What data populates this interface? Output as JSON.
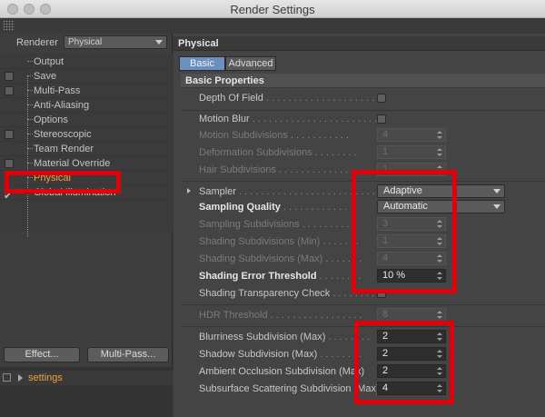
{
  "window": {
    "title": "Render Settings"
  },
  "renderer": {
    "label": "Renderer",
    "value": "Physical"
  },
  "tree": {
    "items": [
      {
        "label": "Output",
        "checkbox": false
      },
      {
        "label": "Save",
        "checkbox": true
      },
      {
        "label": "Multi-Pass",
        "checkbox": true
      },
      {
        "label": "Anti-Aliasing",
        "checkbox": false
      },
      {
        "label": "Options",
        "checkbox": false
      },
      {
        "label": "Stereoscopic",
        "checkbox": true
      },
      {
        "label": "Team Render",
        "checkbox": false
      },
      {
        "label": "Material Override",
        "checkbox": true
      },
      {
        "label": "Physical",
        "checkbox": false,
        "selected": true
      },
      {
        "label": "Global Illumination",
        "checkbox": false,
        "checked": true
      }
    ]
  },
  "buttons": {
    "effect": "Effect...",
    "multipass": "Multi-Pass..."
  },
  "presets": {
    "label": "settings"
  },
  "panel": {
    "title": "Physical",
    "tabs": [
      {
        "label": "Basic",
        "active": true
      },
      {
        "label": "Advanced",
        "active": false
      }
    ],
    "section": "Basic Properties",
    "rows": {
      "depth_of_field": {
        "label": "Depth Of Field",
        "dots": " . . . . . . . . . . . . . . . . . . . . ."
      },
      "motion_blur": {
        "label": "Motion Blur",
        "dots": " . . . . . . . . . . . . . . . . . . . . . . . ."
      },
      "motion_subdivisions": {
        "label": "Motion Subdivisions",
        "dots": " . . . . . . . . . . .",
        "value": "4"
      },
      "deformation_subdivisions": {
        "label": "Deformation Subdivisions",
        "dots": " . . . . . . . .",
        "value": "1"
      },
      "hair_subdivisions": {
        "label": "Hair Subdivisions",
        "dots": " . . . . . . . . . . . . . . .",
        "value": "1"
      },
      "sampler": {
        "label": "Sampler",
        "dots": " . . . . . . . . . . . . . . . . . . . . . . . . .",
        "value": "Adaptive"
      },
      "sampling_quality": {
        "label": "Sampling Quality",
        "dots": " . . . . . . . . . . . .",
        "value": "Automatic"
      },
      "sampling_subdivisions": {
        "label": "Sampling Subdivisions",
        "dots": " . . . . . . . . . .",
        "value": "3"
      },
      "shading_subdiv_min": {
        "label": "Shading Subdivisions (Min)",
        "dots": " . . . . . . .",
        "value": "1"
      },
      "shading_subdiv_max": {
        "label": "Shading Subdivisions (Max)",
        "dots": " . . . . . . .",
        "value": "4"
      },
      "shading_error_threshold": {
        "label": "Shading Error Threshold",
        "dots": " . . . . . . . .",
        "value": "10 %"
      },
      "shading_transparency_check": {
        "label": "Shading Transparency Check",
        "dots": " . . . . . . . ."
      },
      "hdr_threshold": {
        "label": "HDR Threshold",
        "dots": " . . . . . . . . . . . . . . . . .",
        "value": "8"
      },
      "blurriness_subdivision": {
        "label": "Blurriness Subdivision (Max)",
        "dots": " . . . . . . . .",
        "value": "2"
      },
      "shadow_subdivision": {
        "label": "Shadow Subdivision (Max)",
        "dots": " . . . . . . . .",
        "value": "2"
      },
      "ao_subdivision": {
        "label": "Ambient Occlusion Subdivision (Max)",
        "dots": "",
        "value": "2"
      },
      "sss_subdivision": {
        "label": "Subsurface Scattering Subdivision (Max)",
        "dots": "",
        "value": "4"
      }
    }
  },
  "colors": {
    "highlight": "#e0000a",
    "selected_text": "#f0a03c",
    "active_tab": "#6a8fc0"
  }
}
